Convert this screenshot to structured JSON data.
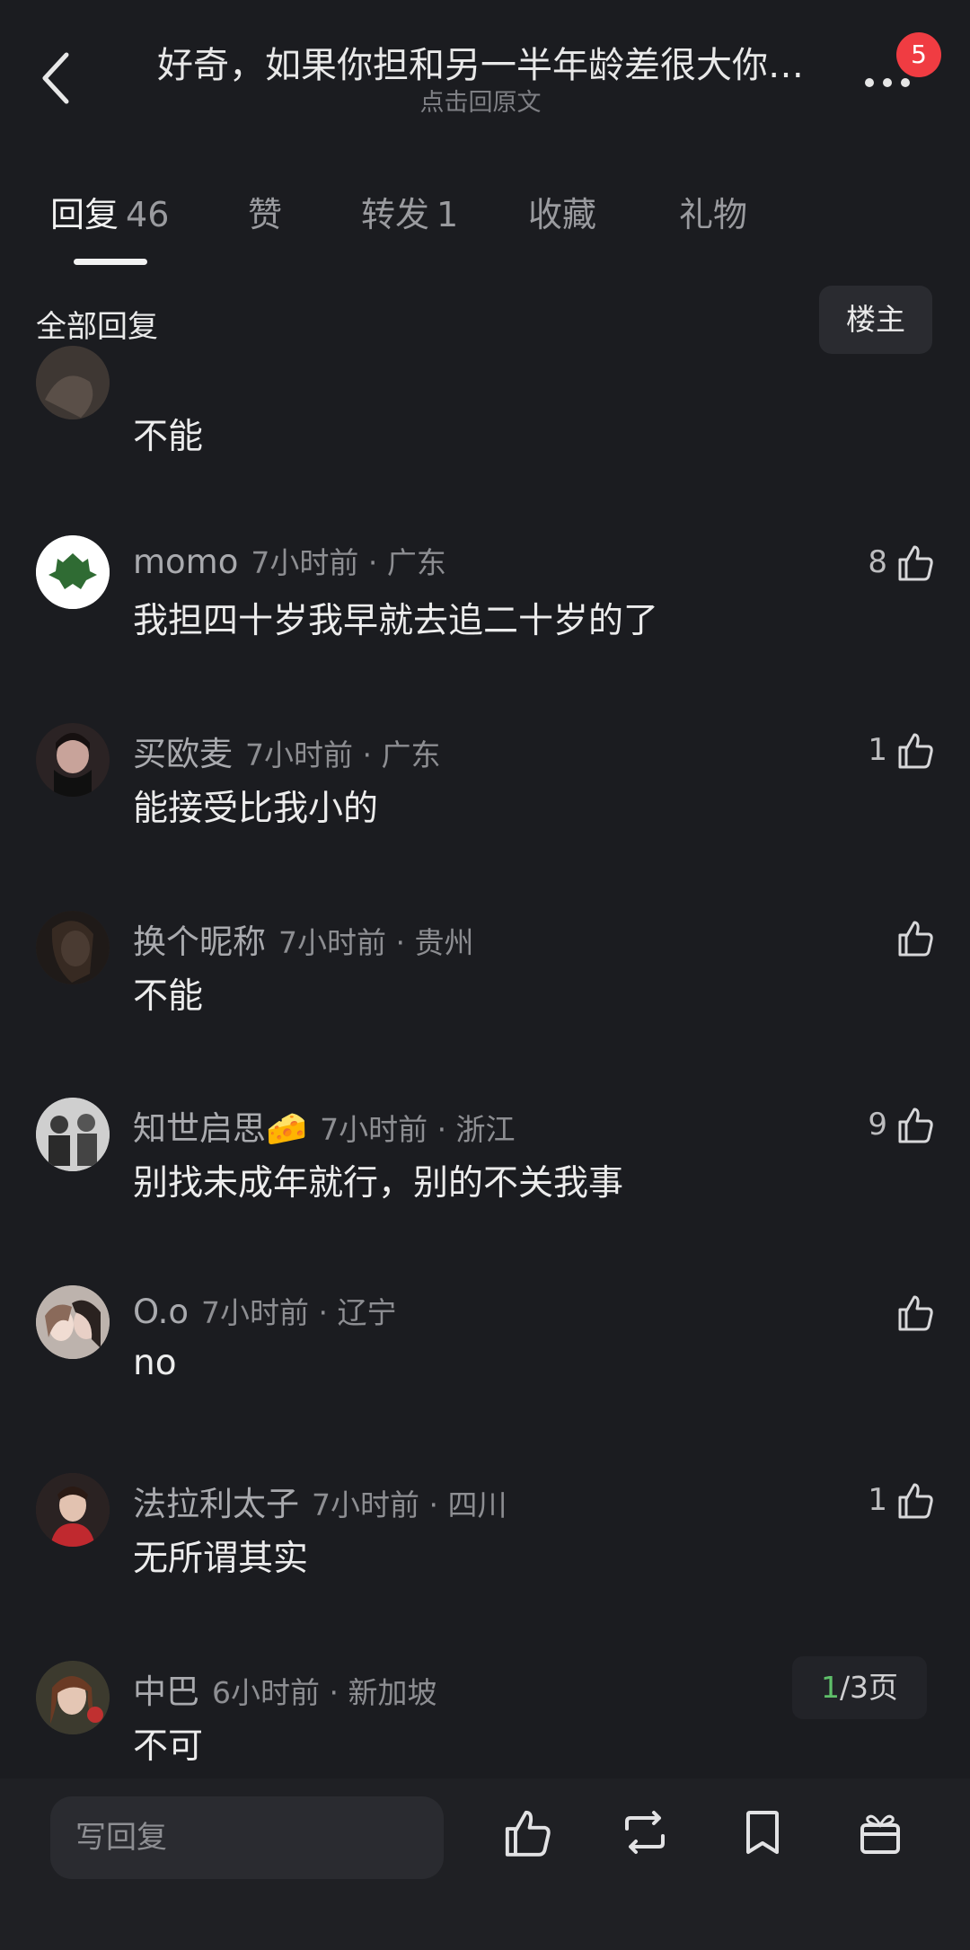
{
  "header": {
    "title": "好奇，如果你担和另一半年龄差很大你…",
    "subtitle": "点击回原文",
    "notification_badge": "5"
  },
  "tabs": [
    {
      "label": "回复",
      "count": "46",
      "active": true
    },
    {
      "label": "赞"
    },
    {
      "label": "转发",
      "count": "1"
    },
    {
      "label": "收藏"
    },
    {
      "label": "礼物"
    }
  ],
  "section_title": "全部回复",
  "owner_filter_label": "楼主",
  "comments": [
    {
      "username": "",
      "time_location": "",
      "text": "不能",
      "likes": ""
    },
    {
      "username": "momo",
      "time_location": "7小时前 · 广东",
      "text": "我担四十岁我早就去追二十岁的了",
      "likes": "8"
    },
    {
      "username": "买欧麦",
      "time_location": "7小时前 · 广东",
      "text": "能接受比我小的",
      "likes": "1"
    },
    {
      "username": "换个昵称",
      "time_location": "7小时前 · 贵州",
      "text": "不能",
      "likes": ""
    },
    {
      "username": "知世启思🧀",
      "time_location": "7小时前 · 浙江",
      "text": "别找未成年就行，别的不关我事",
      "likes": "9"
    },
    {
      "username": "O.o",
      "time_location": "7小时前 · 辽宁",
      "text": "no",
      "likes": ""
    },
    {
      "username": "法拉利太子",
      "time_location": "7小时前 · 四川",
      "text": "无所谓其实",
      "likes": "1"
    },
    {
      "username": "中巴",
      "time_location": "6小时前 · 新加坡",
      "text": "不可",
      "likes": ""
    }
  ],
  "pagination": {
    "current": "1",
    "total_text": "/3页"
  },
  "bottom_bar": {
    "reply_placeholder": "写回复"
  },
  "colors": {
    "background": "#1b1c20",
    "accent_green": "#5fbf6a",
    "badge_red": "#f03c42"
  }
}
